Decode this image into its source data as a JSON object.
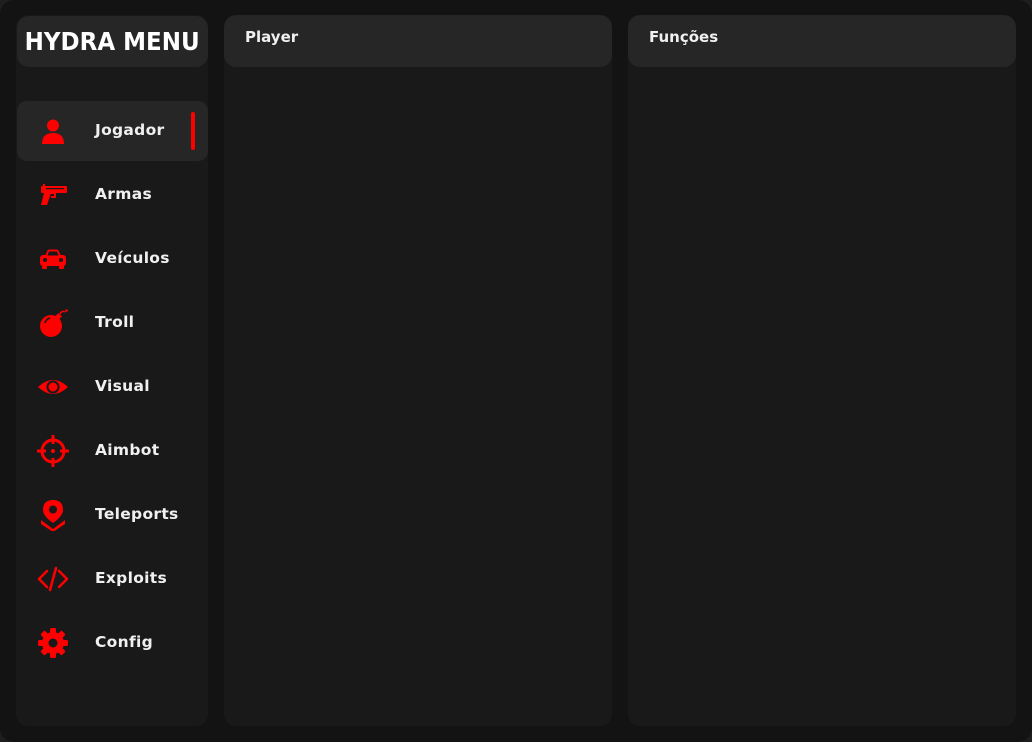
{
  "app": {
    "title": "HYDRA MENU",
    "accent_color": "#ff0000",
    "background_color": "#131313",
    "surface_color": "#191919",
    "header_color": "#262626"
  },
  "sidebar": {
    "items": [
      {
        "label": "Jogador",
        "icon": "user-icon",
        "active": true
      },
      {
        "label": "Armas",
        "icon": "gun-icon",
        "active": false
      },
      {
        "label": "Veículos",
        "icon": "car-icon",
        "active": false
      },
      {
        "label": "Troll",
        "icon": "bomb-icon",
        "active": false
      },
      {
        "label": "Visual",
        "icon": "eye-icon",
        "active": false
      },
      {
        "label": "Aimbot",
        "icon": "crosshair-icon",
        "active": false
      },
      {
        "label": "Teleports",
        "icon": "map-pin-icon",
        "active": false
      },
      {
        "label": "Exploits",
        "icon": "code-icon",
        "active": false
      },
      {
        "label": "Config",
        "icon": "gear-icon",
        "active": false
      }
    ]
  },
  "panels": {
    "left": {
      "title": "Player"
    },
    "right": {
      "title": "Funções"
    }
  }
}
